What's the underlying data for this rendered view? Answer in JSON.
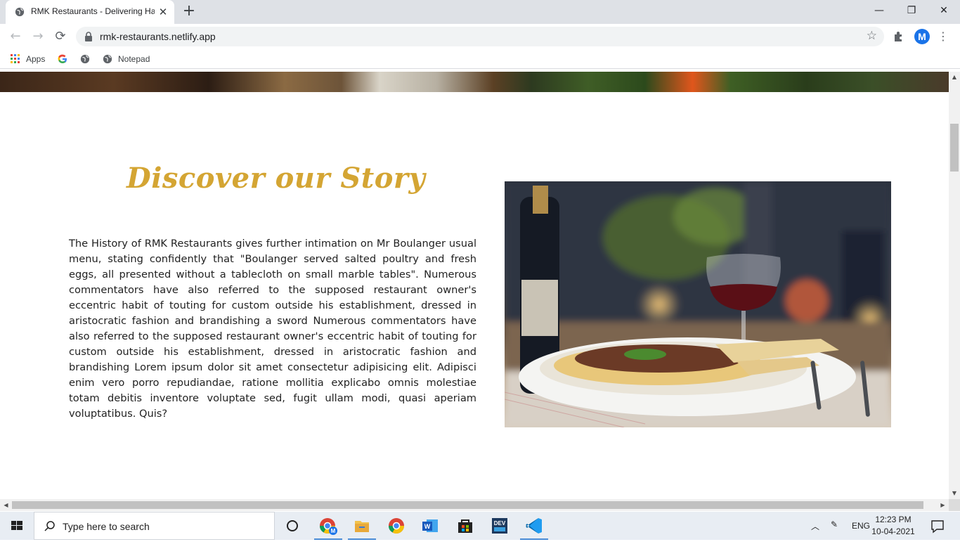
{
  "browser": {
    "tab_title": "RMK Restaurants - Delivering Happiness",
    "url": "rmk-restaurants.netlify.app",
    "bookmarks": [
      {
        "label": "Apps",
        "icon": "apps-grid-icon"
      },
      {
        "label": "",
        "icon": "google-icon"
      },
      {
        "label": "",
        "icon": "globe-icon"
      },
      {
        "label": "Notepad",
        "icon": "globe-icon"
      }
    ],
    "profile_initial": "M"
  },
  "page": {
    "story_title": "Discover our Story",
    "story_text": "The History of RMK Restaurants gives further intimation on Mr Boulanger usual menu, stating confidently that \"Boulanger served salted poultry and fresh eggs, all presented without a tablecloth on small marble tables\". Numerous commentators have also referred to the supposed restaurant owner's eccentric habit of touting for custom outside his establishment, dressed in aristocratic fashion and brandishing a sword Numerous commentators have also referred to the supposed restaurant owner's eccentric habit of touting for custom outside his establishment, dressed in aristocratic fashion and brandishing Lorem ipsum dolor sit amet consectetur adipisicing elit. Adipisci enim vero porro repudiandae, ratione mollitia explicabo omnis molestiae totam debitis inventore voluptate sed, fugit ullam modi, quasi aperiam voluptatibus. Quis?",
    "accent_color": "#d4a533"
  },
  "taskbar": {
    "search_placeholder": "Type here to search",
    "language": "ENG",
    "time": "12:23 PM",
    "date": "10-04-2021"
  }
}
